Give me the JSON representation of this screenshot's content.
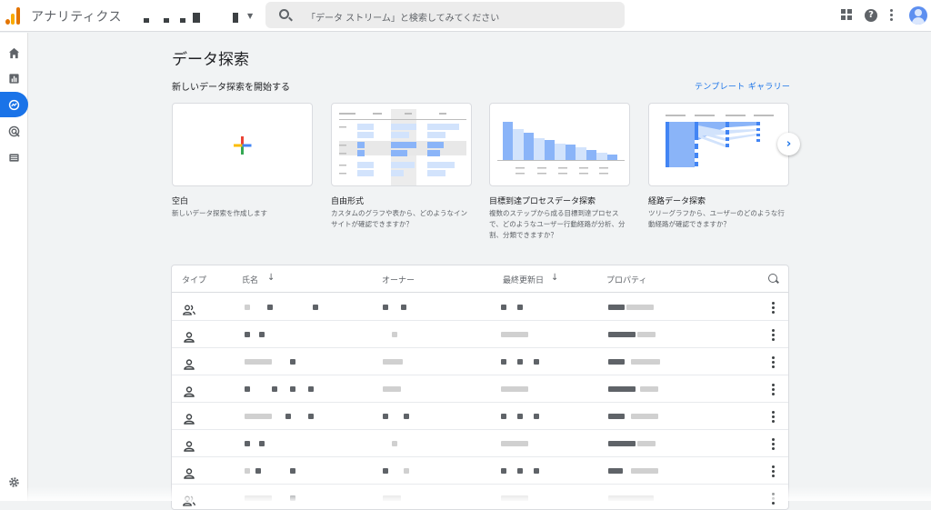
{
  "app": {
    "title": "アナリティクス"
  },
  "search": {
    "placeholder": "「データ ストリーム」と検索してみてください"
  },
  "page": {
    "title": "データ探索",
    "section_title": "新しいデータ探索を開始する",
    "gallery_link": "テンプレート ギャラリー"
  },
  "templates": [
    {
      "title": "空白",
      "description": "新しいデータ探索を作成します"
    },
    {
      "title": "自由形式",
      "description": "カスタムのグラフや表から、どのようなインサイトが確認できますか？"
    },
    {
      "title": "目標到達プロセスデータ探索",
      "description": "複数のステップから成る目標到達プロセスで、どのようなユーザー行動経路が分析、分割、分類できますか？"
    },
    {
      "title": "経路データ探索",
      "description": "ツリーグラフから、ユーザーのどのような行動経路が確認できますか？"
    }
  ],
  "table": {
    "columns": [
      "タイプ",
      "氏名",
      "オーナー",
      "最終更新日",
      "プロパティ"
    ],
    "rows": [
      {
        "type": "shared"
      },
      {
        "type": "person"
      },
      {
        "type": "person"
      },
      {
        "type": "person"
      },
      {
        "type": "person"
      },
      {
        "type": "person"
      },
      {
        "type": "person"
      },
      {
        "type": "shared"
      }
    ]
  },
  "colors": {
    "accent": "#1a73e8",
    "logo_orange": "#f9ab00",
    "logo_dark": "#e37400",
    "chart_blue": "#8ab4f8"
  }
}
